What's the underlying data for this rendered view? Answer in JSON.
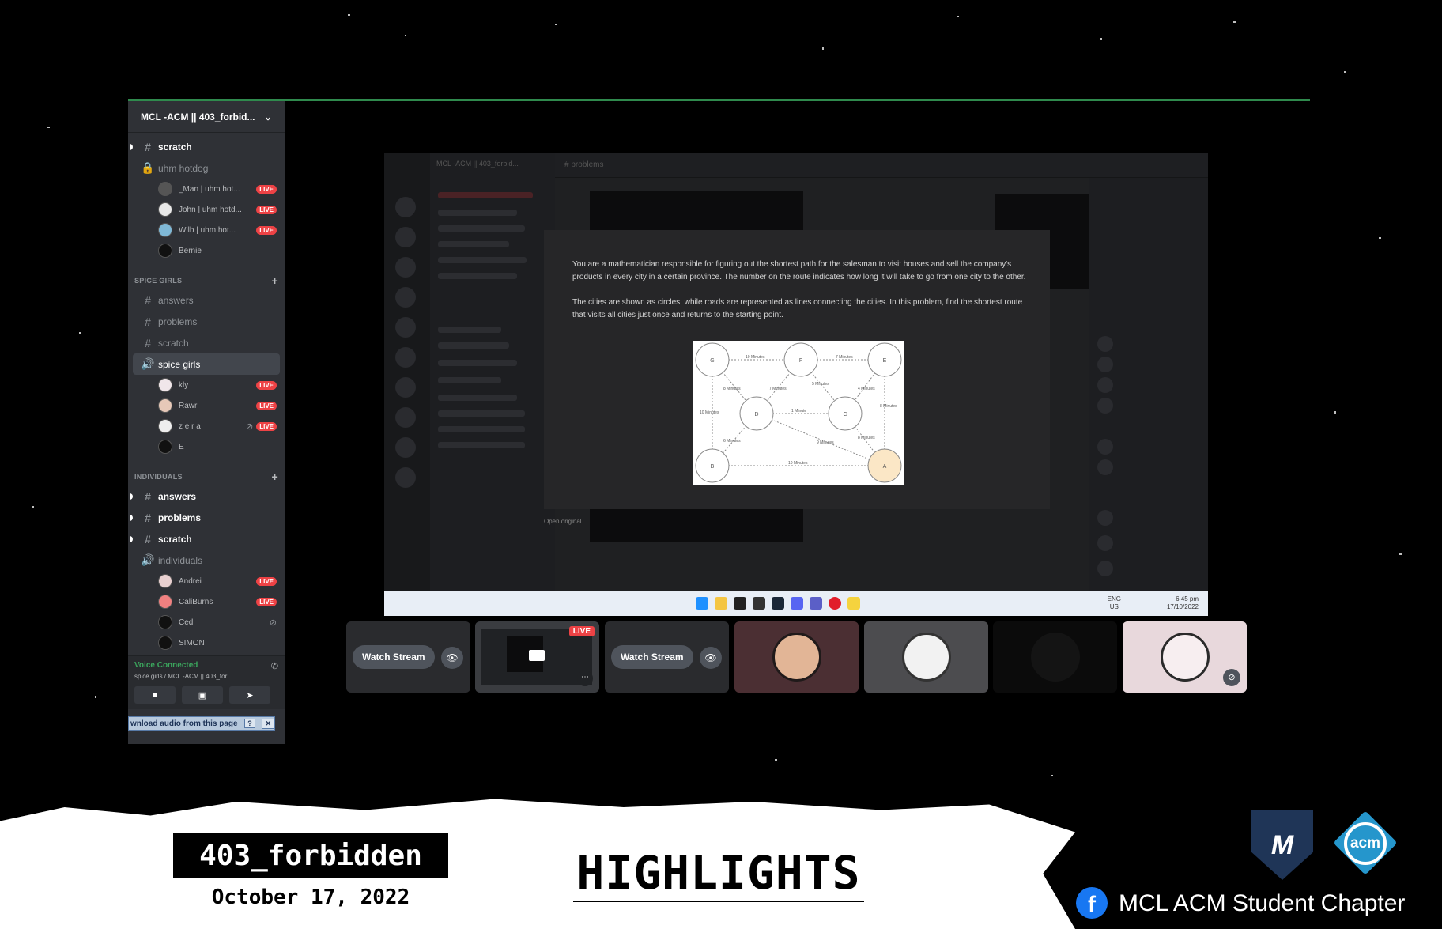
{
  "sidebar": {
    "server_name": "MCL -ACM || 403_forbid...",
    "top_channels": [
      {
        "label": "scratch",
        "type": "text",
        "bold": true,
        "unread": true
      },
      {
        "label": "uhm hotdog",
        "type": "locked"
      }
    ],
    "uhm_hotdog_users": [
      {
        "name": "_Man | uhm hot...",
        "live": true
      },
      {
        "name": "John | uhm hotd...",
        "live": true
      },
      {
        "name": "Wilb | uhm hot...",
        "live": true
      },
      {
        "name": "Bernie",
        "live": false
      }
    ],
    "category_spice": "SPICE GIRLS",
    "spice_channels": [
      "answers",
      "problems",
      "scratch"
    ],
    "spice_voice": "spice girls",
    "spice_users": [
      {
        "name": "kly",
        "live": true
      },
      {
        "name": "Rawr",
        "live": true
      },
      {
        "name": "z e r a",
        "live": true,
        "muted": true
      },
      {
        "name": "E",
        "live": false
      }
    ],
    "category_individuals": "INDIVIDUALS",
    "individual_channels": [
      "answers",
      "problems",
      "scratch"
    ],
    "individual_voice": "individuals",
    "individual_users": [
      {
        "name": "Andrei",
        "live": true
      },
      {
        "name": "CaliBurns",
        "live": true
      },
      {
        "name": "Ced",
        "live": false,
        "muted": true
      },
      {
        "name": "SIMON",
        "live": false
      }
    ],
    "live_label": "LIVE",
    "voice_status": "Voice Connected",
    "voice_location": "spice girls / MCL -ACM || 403_for...",
    "download_bar": "wnload audio from this page"
  },
  "share": {
    "ghost_server": "MCL -ACM || 403_forbid...",
    "ghost_channel": "problems",
    "problem_p1": "You are a mathematician responsible for figuring out the shortest path for the salesman to visit houses and sell the company's products in every city in a certain province. The number on the route indicates how long it will take to go from one city to the other.",
    "problem_p2": "The cities are shown as circles, while roads are represented as lines connecting the cities. In this problem, find the shortest route that visits all cities just once and returns to the starting point.",
    "open_original": "Open original",
    "graph": {
      "nodes": [
        "G",
        "F",
        "E",
        "D",
        "C",
        "B",
        "A"
      ],
      "edge_labels": [
        "10 Minutes",
        "7 Minutes",
        "8 Minutes",
        "7 Minutes",
        "5 Minutes",
        "4 Minutes",
        "10 Minutes",
        "1 Minute",
        "8 Minutes",
        "6 Minutes",
        "9 Minutes",
        "8 Minutes",
        "10 Minutes"
      ]
    },
    "tray_lang_1": "ENG",
    "tray_lang_2": "US",
    "tray_time": "6:45 pm",
    "tray_date": "17/10/2022"
  },
  "tiles": {
    "watch_stream": "Watch Stream",
    "live": "LIVE"
  },
  "banner": {
    "team": "403_forbidden",
    "date": "October 17, 2022",
    "title": "HIGHLIGHTS",
    "chapter": "MCL ACM Student Chapter",
    "acm_logo_text": "acm"
  },
  "colors": {
    "discord_sidebar": "#2f3136",
    "live_red": "#ed4245",
    "voice_green": "#3ba55d",
    "facebook_blue": "#1877f2",
    "acm_blue": "#2596cc"
  }
}
